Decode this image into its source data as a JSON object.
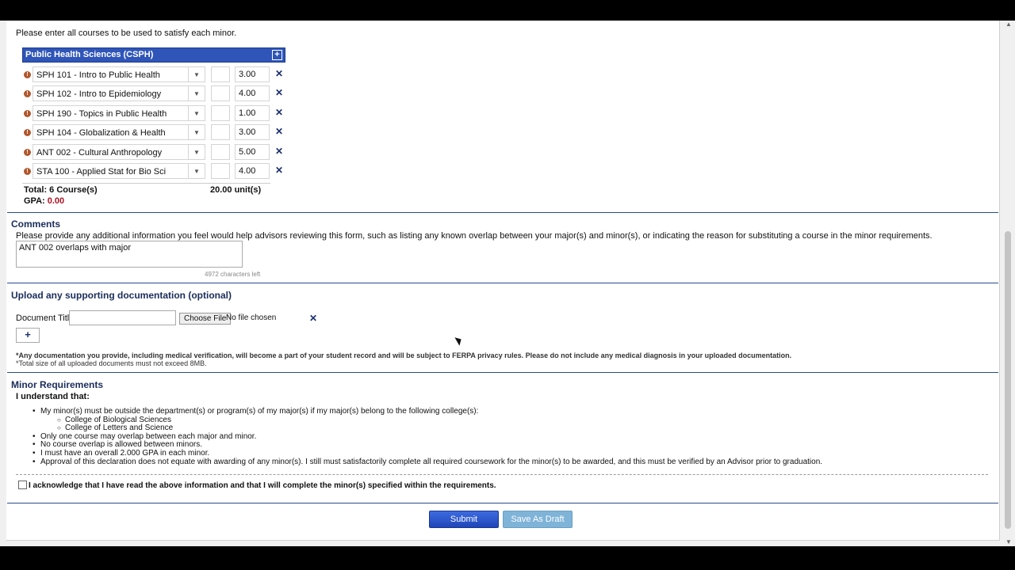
{
  "intro": "Please enter all courses to be used to satisfy each minor.",
  "panel": {
    "title": "Public Health Sciences (CSPH)",
    "courses": [
      {
        "name": "SPH 101 - Intro to Public Health",
        "units": "3.00"
      },
      {
        "name": "SPH 102 - Intro to Epidemiology",
        "units": "4.00"
      },
      {
        "name": "SPH 190 - Topics in Public Health",
        "units": "1.00"
      },
      {
        "name": "SPH 104 - Globalization & Health",
        "units": "3.00"
      },
      {
        "name": "ANT 002 - Cultural Anthropology",
        "units": "5.00"
      },
      {
        "name": "STA 100 - Applied Stat for Bio Sci",
        "units": "4.00"
      }
    ],
    "total_label": "Total: 6 Course(s)",
    "total_units": "20.00 unit(s)",
    "gpa_label": "GPA:",
    "gpa_value": "0.00"
  },
  "comments": {
    "title": "Comments",
    "help": "Please provide any additional information you feel would help advisors reviewing this form, such as listing any known overlap between your major(s) and minor(s), or indicating the reason for substituting a course in the minor requirements.",
    "value": "ANT 002 overlaps with major",
    "chars_left": "4972 characters left"
  },
  "upload": {
    "title": "Upload any supporting documentation (optional)",
    "doc_label": "Document Title:",
    "choose_file": "Choose File",
    "no_file": "No file chosen",
    "add": "+",
    "note1": "*Any documentation you provide, including medical verification, will become a part of your student record and will be subject to FERPA privacy rules. Please do not include any medical diagnosis in your uploaded documentation.",
    "note2": "*Total size of all uploaded documents must not exceed 8MB."
  },
  "requirements": {
    "title": "Minor Requirements",
    "lead": "I understand that:",
    "item1": "My minor(s) must be outside the department(s) or program(s) of my major(s) if my major(s) belong to the following college(s):",
    "college1": "College of Biological Sciences",
    "college2": "College of Letters and Science",
    "item2": "Only one course may overlap between each major and minor.",
    "item3": "No course overlap is allowed between minors.",
    "item4": "I must have an overall 2.000 GPA in each minor.",
    "item5": "Approval of this declaration does not equate with awarding of any minor(s). I still must satisfactorily complete all required coursework for the minor(s) to be awarded, and this must be verified by an Advisor prior to graduation.",
    "acknowledge": "I acknowledge that I have read the above information and that I will complete the minor(s) specified within the requirements."
  },
  "actions": {
    "submit": "Submit",
    "draft": "Save As Draft"
  },
  "icons": {
    "warning": "exclamation-circle-icon",
    "remove": "close-icon",
    "dropdown": "chevron-down-icon",
    "add": "plus-box-icon"
  },
  "colors": {
    "panel_header": "#2f55b8",
    "submit": "#2f55c8",
    "draft": "#7fb3d8",
    "gpa": "#b01020",
    "warning": "#b1562b"
  }
}
